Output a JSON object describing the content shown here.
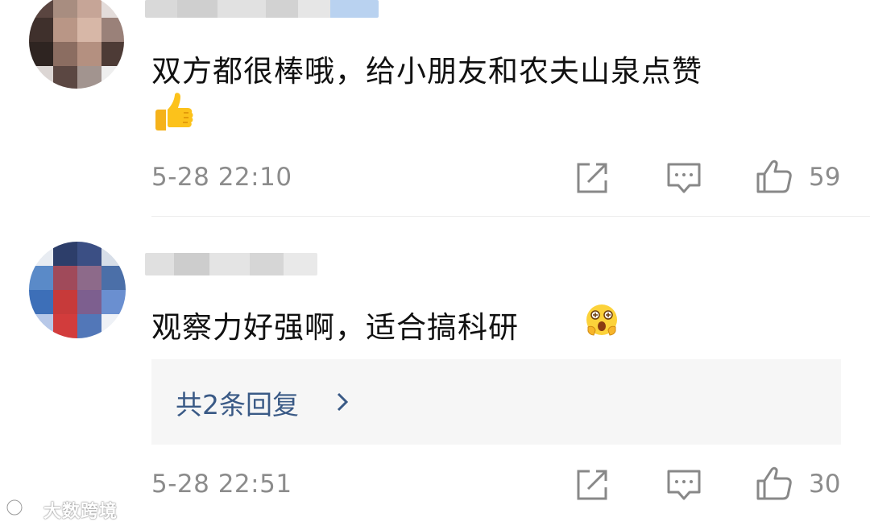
{
  "comments": [
    {
      "text": "双方都很棒哦，给小朋友和农夫山泉点赞",
      "emoji": "thumbs-up",
      "timestamp": "5-28 22:10",
      "likes": "59"
    },
    {
      "text": "观察力好强啊，适合搞科研",
      "emoji": "hand-over-mouth-surprised-face",
      "reply_link": "共2条回复",
      "timestamp": "5-28 22:51",
      "likes": "30"
    }
  ],
  "watermark": {
    "text": "大数跨境"
  },
  "colors": {
    "text": "#111111",
    "meta": "#8c8c8c",
    "link": "#3a5a86",
    "reply_bg": "#f6f6f6",
    "divider": "#ececec"
  },
  "icons": {
    "share": "share-icon",
    "comment": "comment-icon",
    "like": "thumbs-up-outline-icon"
  }
}
